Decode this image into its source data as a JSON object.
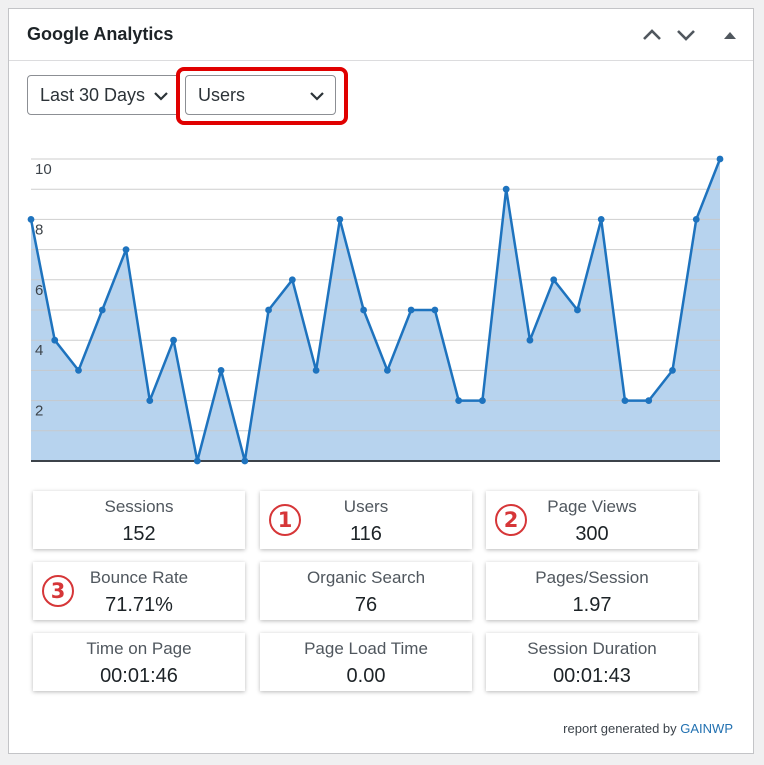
{
  "widget": {
    "title": "Google Analytics"
  },
  "header_buttons": [
    {
      "name": "move-up-icon"
    },
    {
      "name": "move-down-icon"
    },
    {
      "name": "collapse-icon"
    }
  ],
  "filters": {
    "period": {
      "selected": "Last 30 Days"
    },
    "metric": {
      "selected": "Users"
    }
  },
  "chart_data": {
    "type": "area",
    "x": [
      1,
      2,
      3,
      4,
      5,
      6,
      7,
      8,
      9,
      10,
      11,
      12,
      13,
      14,
      15,
      16,
      17,
      18,
      19,
      20,
      21,
      22,
      23,
      24,
      25,
      26,
      27,
      28,
      29,
      30
    ],
    "series": [
      {
        "values": [
          8,
          4,
          3,
          5,
          7,
          2,
          4,
          0,
          3,
          0,
          5,
          6,
          3,
          8,
          5,
          3,
          5,
          5,
          2,
          2,
          9,
          4,
          6,
          5,
          8,
          2,
          2,
          3,
          8,
          10
        ]
      }
    ],
    "yticks": [
      "2",
      "4",
      "6",
      "8",
      "10"
    ],
    "ylim": [
      0,
      10
    ],
    "grid": true,
    "line_color": "#1e73be",
    "fill_color": "#b7d3ee"
  },
  "metrics": [
    {
      "label": "Sessions",
      "value": "152"
    },
    {
      "label": "Users",
      "value": "116",
      "badge": "1"
    },
    {
      "label": "Page Views",
      "value": "300",
      "badge": "2"
    },
    {
      "label": "Bounce Rate",
      "value": "71.71%",
      "badge": "3"
    },
    {
      "label": "Organic Search",
      "value": "76"
    },
    {
      "label": "Pages/Session",
      "value": "1.97"
    },
    {
      "label": "Time on Page",
      "value": "00:01:46"
    },
    {
      "label": "Page Load Time",
      "value": "0.00"
    },
    {
      "label": "Session Duration",
      "value": "00:01:43"
    }
  ],
  "footer": {
    "text": "report generated by",
    "link": "GAINWP"
  },
  "colors": {
    "annotation": "#d63638",
    "link": "#2271b1",
    "highlight": "#e00000"
  }
}
